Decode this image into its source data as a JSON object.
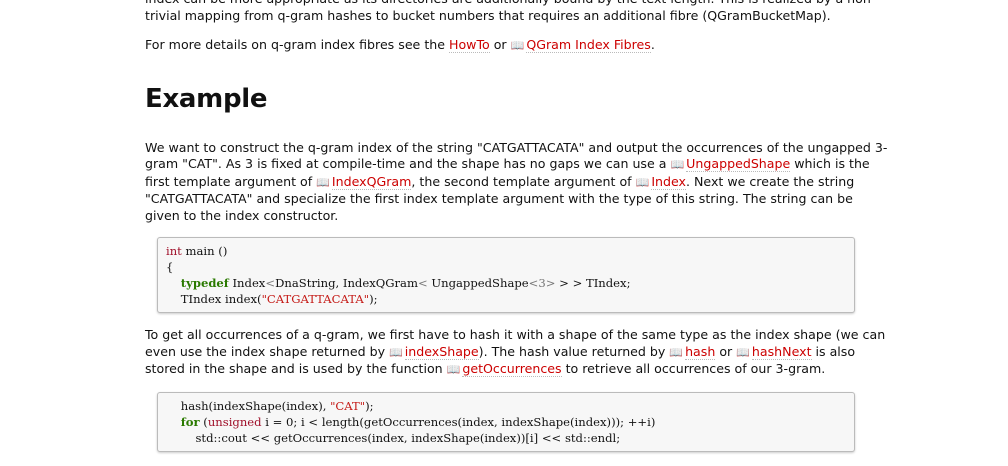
{
  "intro": {
    "line1": "index can be more appropriate as its directories are additionally bound by the text length. This is realized by a non-trivial mapping from q-gram hashes to bucket numbers that requires an additional fibre (QGramBucketMap).",
    "more_prefix": "For more details on q-gram index fibres see the ",
    "howto": "HowTo",
    "or": " or ",
    "fibres_link": "QGram Index Fibres",
    "end": "."
  },
  "heading": "Example",
  "para1": {
    "t1": "We want to construct the q-gram index of the string \"CATGATTACATA\" and output the occurrences of the ungapped 3-gram \"CAT\". As 3 is fixed at compile-time and the shape has no gaps we can use a ",
    "l1": "UngappedShape",
    "t2": " which is the first template argument of ",
    "l2": "IndexQGram",
    "t3": ", the second template argument of ",
    "l3": "Index",
    "t4": ". Next we create the string \"CATGATTACATA\" and specialize the first index template argument with the type of this string. The string can be given to the index constructor."
  },
  "code1": {
    "l1_kw": "int",
    "l1_rest": " main ()",
    "l2": "{",
    "l3_kw": "typedef",
    "l3_a": " Index",
    "l3_b": "<",
    "l3_c": "DnaString, IndexQGram",
    "l3_d": "<",
    "l3_e": " UngappedShape",
    "l3_f": "<3>",
    "l3_g": " > > TIndex;",
    "l4_a": "TIndex index(",
    "l4_str": "\"CATGATTACATA\"",
    "l4_b": ");"
  },
  "para2": {
    "t1": "To get all occurrences of a q-gram, we first have to hash it with a shape of the same type as the index shape (we can even use the index shape returned by ",
    "l1": "indexShape",
    "t2": "). The hash value returned by ",
    "l2": "hash",
    "t3": " or ",
    "l3": "hashNext",
    "t4": " is also stored in the shape and is used by the function ",
    "l4": "getOccurrences",
    "t5": " to retrieve all occurrences of our 3-gram."
  },
  "code2": {
    "l1_a": "hash(indexShape(index), ",
    "l1_str": "\"CAT\"",
    "l1_b": ");",
    "l2_kw": "for",
    "l2_a": " (",
    "l2_ty": "unsigned",
    "l2_b": " i = 0; i < length(getOccurrences(index, indexShape(index))); ++i)",
    "l3": "std::cout << getOccurrences(index, indexShape(index))[i] << std::endl;"
  }
}
